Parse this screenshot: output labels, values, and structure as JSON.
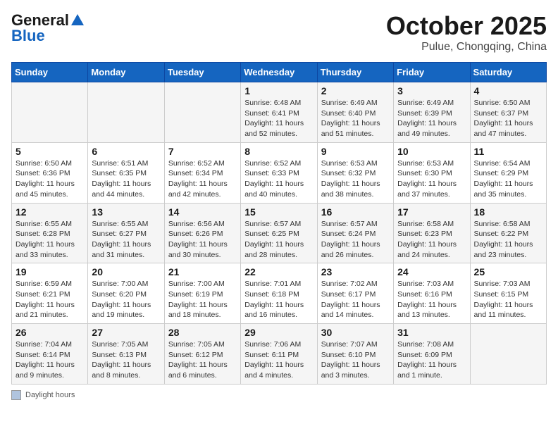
{
  "header": {
    "logo_general": "General",
    "logo_blue": "Blue",
    "title": "October 2025",
    "subtitle": "Pulue, Chongqing, China"
  },
  "weekdays": [
    "Sunday",
    "Monday",
    "Tuesday",
    "Wednesday",
    "Thursday",
    "Friday",
    "Saturday"
  ],
  "weeks": [
    [
      {
        "day": "",
        "info": ""
      },
      {
        "day": "",
        "info": ""
      },
      {
        "day": "",
        "info": ""
      },
      {
        "day": "1",
        "info": "Sunrise: 6:48 AM\nSunset: 6:41 PM\nDaylight: 11 hours\nand 52 minutes."
      },
      {
        "day": "2",
        "info": "Sunrise: 6:49 AM\nSunset: 6:40 PM\nDaylight: 11 hours\nand 51 minutes."
      },
      {
        "day": "3",
        "info": "Sunrise: 6:49 AM\nSunset: 6:39 PM\nDaylight: 11 hours\nand 49 minutes."
      },
      {
        "day": "4",
        "info": "Sunrise: 6:50 AM\nSunset: 6:37 PM\nDaylight: 11 hours\nand 47 minutes."
      }
    ],
    [
      {
        "day": "5",
        "info": "Sunrise: 6:50 AM\nSunset: 6:36 PM\nDaylight: 11 hours\nand 45 minutes."
      },
      {
        "day": "6",
        "info": "Sunrise: 6:51 AM\nSunset: 6:35 PM\nDaylight: 11 hours\nand 44 minutes."
      },
      {
        "day": "7",
        "info": "Sunrise: 6:52 AM\nSunset: 6:34 PM\nDaylight: 11 hours\nand 42 minutes."
      },
      {
        "day": "8",
        "info": "Sunrise: 6:52 AM\nSunset: 6:33 PM\nDaylight: 11 hours\nand 40 minutes."
      },
      {
        "day": "9",
        "info": "Sunrise: 6:53 AM\nSunset: 6:32 PM\nDaylight: 11 hours\nand 38 minutes."
      },
      {
        "day": "10",
        "info": "Sunrise: 6:53 AM\nSunset: 6:30 PM\nDaylight: 11 hours\nand 37 minutes."
      },
      {
        "day": "11",
        "info": "Sunrise: 6:54 AM\nSunset: 6:29 PM\nDaylight: 11 hours\nand 35 minutes."
      }
    ],
    [
      {
        "day": "12",
        "info": "Sunrise: 6:55 AM\nSunset: 6:28 PM\nDaylight: 11 hours\nand 33 minutes."
      },
      {
        "day": "13",
        "info": "Sunrise: 6:55 AM\nSunset: 6:27 PM\nDaylight: 11 hours\nand 31 minutes."
      },
      {
        "day": "14",
        "info": "Sunrise: 6:56 AM\nSunset: 6:26 PM\nDaylight: 11 hours\nand 30 minutes."
      },
      {
        "day": "15",
        "info": "Sunrise: 6:57 AM\nSunset: 6:25 PM\nDaylight: 11 hours\nand 28 minutes."
      },
      {
        "day": "16",
        "info": "Sunrise: 6:57 AM\nSunset: 6:24 PM\nDaylight: 11 hours\nand 26 minutes."
      },
      {
        "day": "17",
        "info": "Sunrise: 6:58 AM\nSunset: 6:23 PM\nDaylight: 11 hours\nand 24 minutes."
      },
      {
        "day": "18",
        "info": "Sunrise: 6:58 AM\nSunset: 6:22 PM\nDaylight: 11 hours\nand 23 minutes."
      }
    ],
    [
      {
        "day": "19",
        "info": "Sunrise: 6:59 AM\nSunset: 6:21 PM\nDaylight: 11 hours\nand 21 minutes."
      },
      {
        "day": "20",
        "info": "Sunrise: 7:00 AM\nSunset: 6:20 PM\nDaylight: 11 hours\nand 19 minutes."
      },
      {
        "day": "21",
        "info": "Sunrise: 7:00 AM\nSunset: 6:19 PM\nDaylight: 11 hours\nand 18 minutes."
      },
      {
        "day": "22",
        "info": "Sunrise: 7:01 AM\nSunset: 6:18 PM\nDaylight: 11 hours\nand 16 minutes."
      },
      {
        "day": "23",
        "info": "Sunrise: 7:02 AM\nSunset: 6:17 PM\nDaylight: 11 hours\nand 14 minutes."
      },
      {
        "day": "24",
        "info": "Sunrise: 7:03 AM\nSunset: 6:16 PM\nDaylight: 11 hours\nand 13 minutes."
      },
      {
        "day": "25",
        "info": "Sunrise: 7:03 AM\nSunset: 6:15 PM\nDaylight: 11 hours\nand 11 minutes."
      }
    ],
    [
      {
        "day": "26",
        "info": "Sunrise: 7:04 AM\nSunset: 6:14 PM\nDaylight: 11 hours\nand 9 minutes."
      },
      {
        "day": "27",
        "info": "Sunrise: 7:05 AM\nSunset: 6:13 PM\nDaylight: 11 hours\nand 8 minutes."
      },
      {
        "day": "28",
        "info": "Sunrise: 7:05 AM\nSunset: 6:12 PM\nDaylight: 11 hours\nand 6 minutes."
      },
      {
        "day": "29",
        "info": "Sunrise: 7:06 AM\nSunset: 6:11 PM\nDaylight: 11 hours\nand 4 minutes."
      },
      {
        "day": "30",
        "info": "Sunrise: 7:07 AM\nSunset: 6:10 PM\nDaylight: 11 hours\nand 3 minutes."
      },
      {
        "day": "31",
        "info": "Sunrise: 7:08 AM\nSunset: 6:09 PM\nDaylight: 11 hours\nand 1 minute."
      },
      {
        "day": "",
        "info": ""
      }
    ]
  ],
  "footer": {
    "daylight_label": "Daylight hours"
  }
}
